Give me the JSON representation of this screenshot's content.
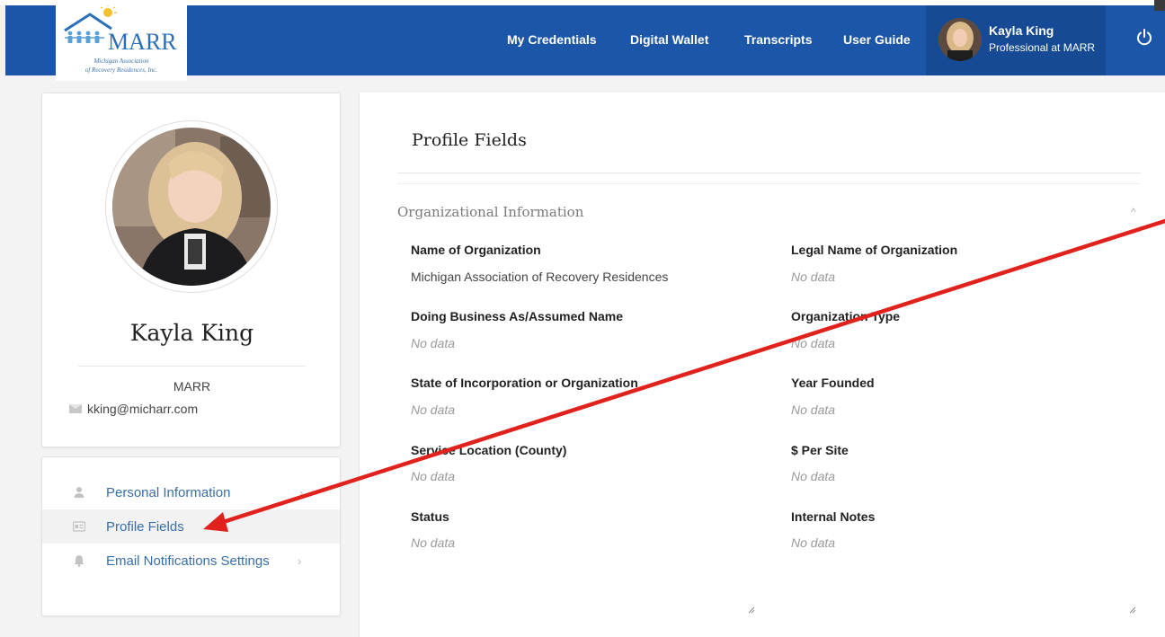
{
  "header": {
    "logo": {
      "word": "MARR",
      "sub1": "Michigan Association",
      "sub2": "of Recovery Residences, Inc."
    },
    "nav": [
      "My Credentials",
      "Digital Wallet",
      "Transcripts",
      "User Guide"
    ],
    "user": {
      "name": "Kayla King",
      "role": "Professional at MARR"
    },
    "colors": {
      "bar": "#1c56a8",
      "user_box": "#164a94"
    }
  },
  "profile": {
    "name": "Kayla King",
    "org": "MARR",
    "email": "kking@micharr.com"
  },
  "menu": [
    {
      "label": "Personal Information",
      "icon": "user-icon"
    },
    {
      "label": "Profile Fields",
      "icon": "id-card-icon"
    },
    {
      "label": "Email Notifications Settings",
      "icon": "bell-icon"
    }
  ],
  "panel": {
    "title": "Profile Fields",
    "section": "Organizational Information",
    "fields": [
      {
        "label": "Name of Organization",
        "value": "Michigan Association of Recovery Residences"
      },
      {
        "label": "Legal Name of Organization",
        "value": "No data"
      },
      {
        "label": "Doing Business As/Assumed Name",
        "value": "No data"
      },
      {
        "label": "Organization Type",
        "value": "No data"
      },
      {
        "label": "State of Incorporation or Organization",
        "value": "No data"
      },
      {
        "label": "Year Founded",
        "value": "No data"
      },
      {
        "label": "Service Location (County)",
        "value": "No data"
      },
      {
        "label": "$ Per Site",
        "value": "No data"
      },
      {
        "label": "Status",
        "value": "No data"
      },
      {
        "label": "Internal Notes",
        "value": "No data"
      }
    ]
  }
}
